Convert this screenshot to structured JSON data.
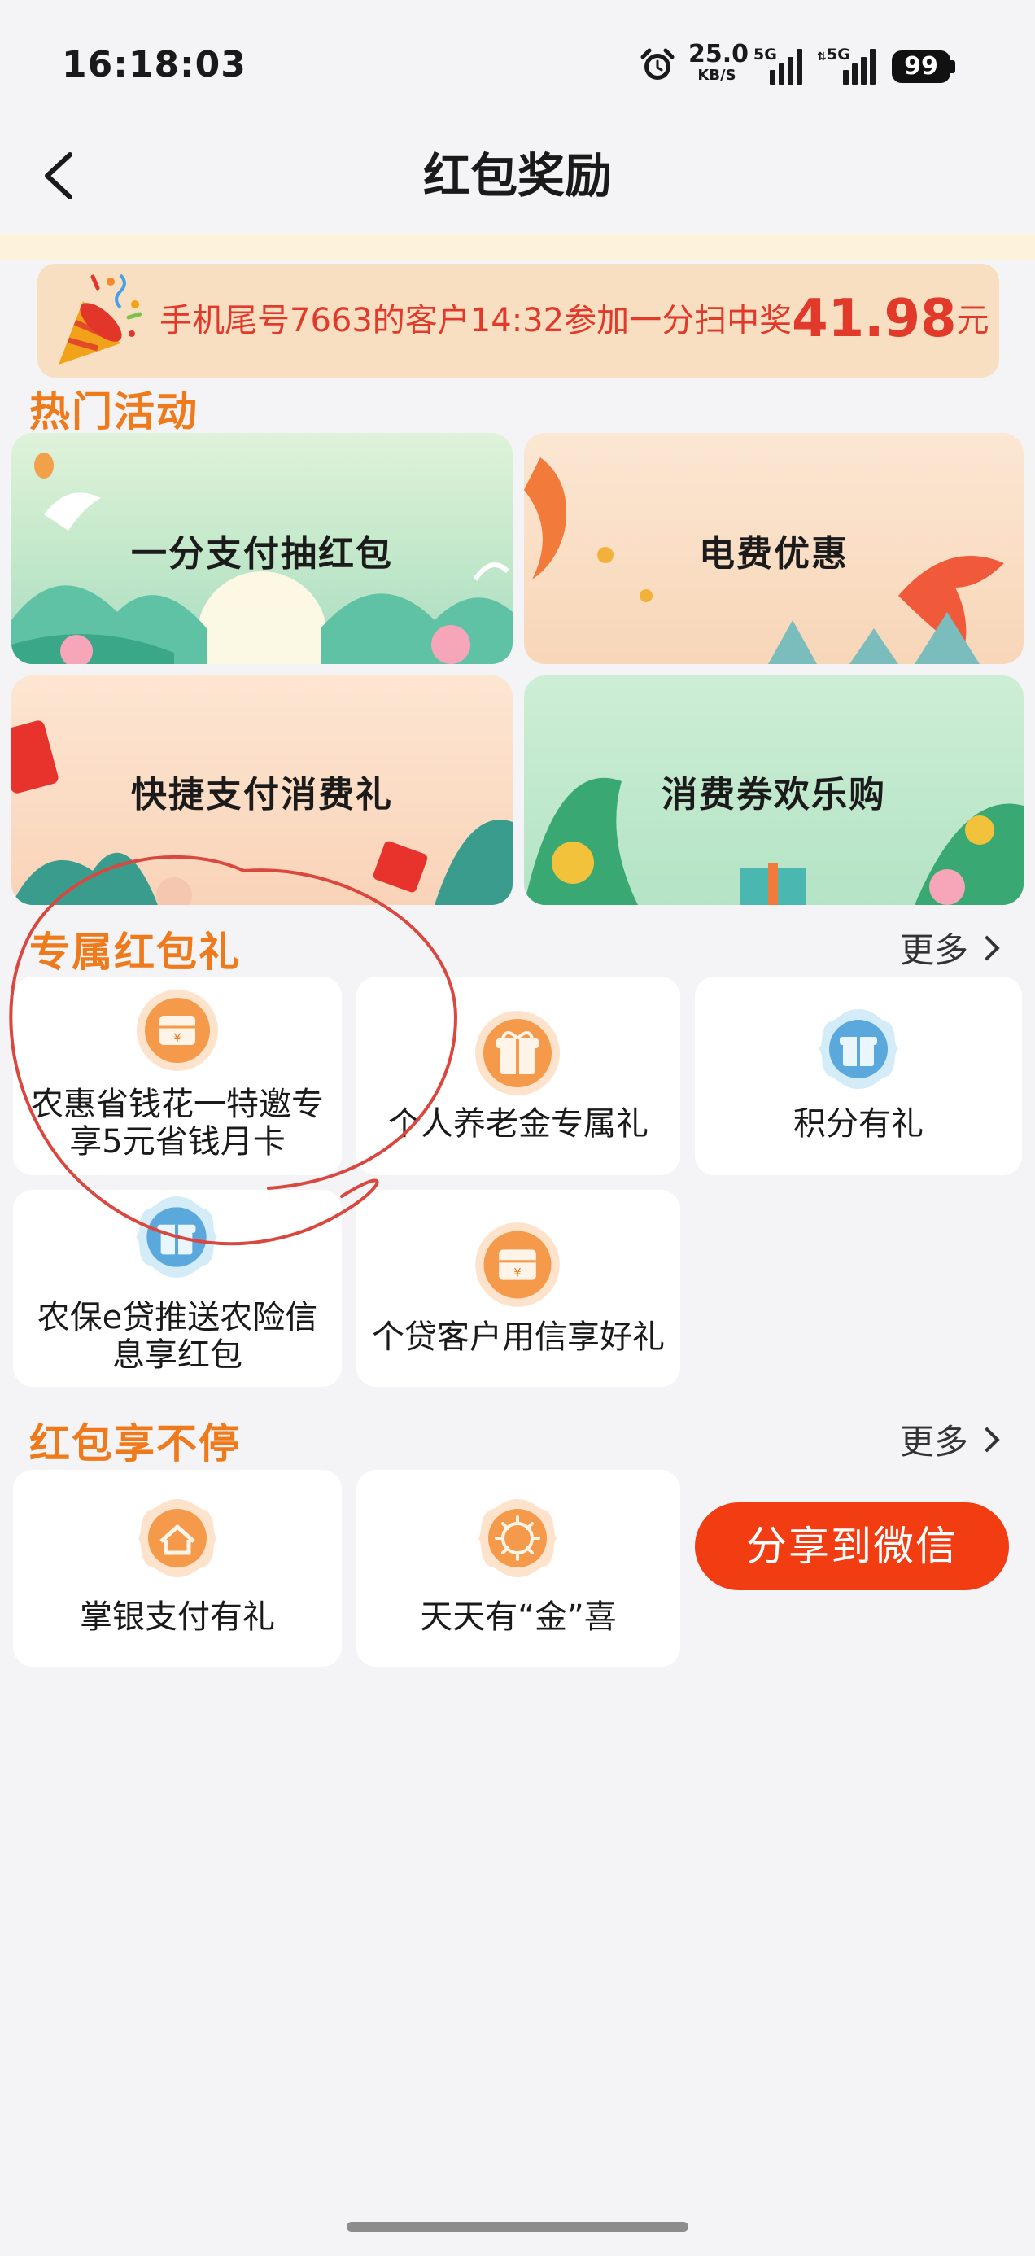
{
  "status_bar": {
    "time": "16:18:03",
    "speed_value": "25.0",
    "speed_unit": "KB/S",
    "sim1_label": "5G",
    "sim2_label": "5G",
    "battery": "99"
  },
  "header": {
    "title": "红包奖励"
  },
  "notice": {
    "text": "手机尾号7663的客户14:32参加一分扫中奖",
    "amount": "41.98",
    "unit": "元"
  },
  "hot": {
    "title": "热门活动",
    "cards": [
      {
        "label": "一分支付抽红包"
      },
      {
        "label": "电费优惠"
      },
      {
        "label": "快捷支付消费礼"
      },
      {
        "label": "消费券欢乐购"
      }
    ]
  },
  "exclusive": {
    "title": "专属红包礼",
    "more": "更多",
    "tiles": [
      {
        "line1": "农惠省钱花一特邀专",
        "line2": "享5元省钱月卡",
        "icon": "coupon-icon"
      },
      {
        "line1": "个人养老金专属礼",
        "icon": "gift-box-icon"
      },
      {
        "line1": "积分有礼",
        "icon": "gift-icon"
      },
      {
        "line1": "农保e贷推送农险信",
        "line2": "息享红包",
        "icon": "gift-icon"
      },
      {
        "line1": "个贷客户用信享好礼",
        "icon": "coupon-icon"
      }
    ]
  },
  "nonstop": {
    "title": "红包享不停",
    "more": "更多",
    "tiles": [
      {
        "label": "掌银支付有礼",
        "icon": "house-icon"
      },
      {
        "label": "天天有“金”喜",
        "icon": "sun-icon"
      }
    ],
    "share_button": "分享到微信"
  },
  "colors": {
    "accent_orange": "#ef7a1c",
    "share_red": "#f23c12",
    "notice_red": "#e23a2a",
    "annotation_red": "#d9473f"
  }
}
